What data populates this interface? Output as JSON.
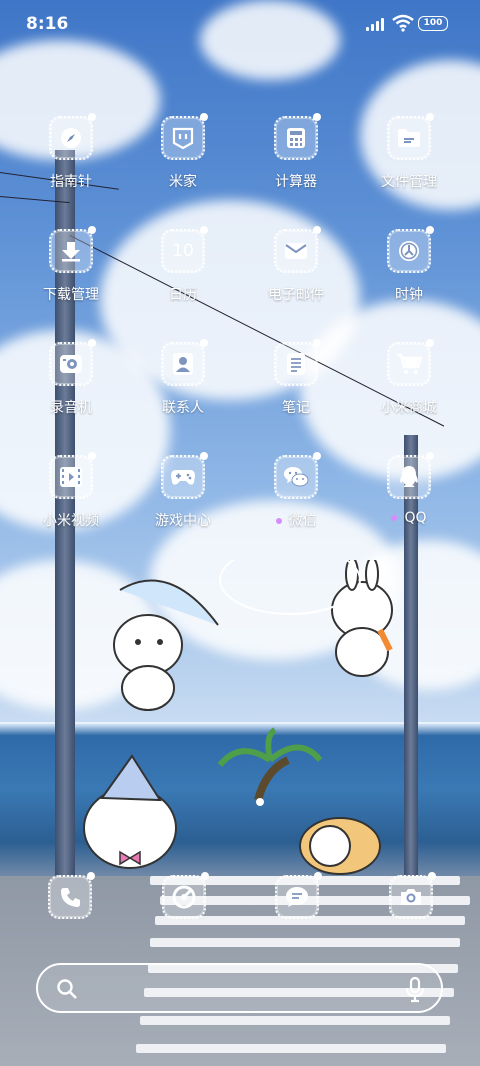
{
  "status_bar": {
    "time": "8:16",
    "battery": "100"
  },
  "apps": [
    {
      "label": "指南针",
      "icon": "compass-icon"
    },
    {
      "label": "米家",
      "icon": "mijia-icon"
    },
    {
      "label": "计算器",
      "icon": "calculator-icon"
    },
    {
      "label": "文件管理",
      "icon": "folder-icon"
    },
    {
      "label": "下载管理",
      "icon": "download-icon"
    },
    {
      "label": "日历",
      "icon": "calendar-icon",
      "glyph_text": "10"
    },
    {
      "label": "电子邮件",
      "icon": "mail-icon"
    },
    {
      "label": "时钟",
      "icon": "clock-icon"
    },
    {
      "label": "录音机",
      "icon": "recorder-icon"
    },
    {
      "label": "联系人",
      "icon": "contacts-icon"
    },
    {
      "label": "笔记",
      "icon": "notes-icon"
    },
    {
      "label": "小米商城",
      "icon": "shop-cart-icon"
    },
    {
      "label": "小米视频",
      "icon": "video-icon"
    },
    {
      "label": "游戏中心",
      "icon": "gamepad-icon"
    },
    {
      "label": "微信",
      "icon": "wechat-icon"
    },
    {
      "label": "QQ",
      "icon": "qq-icon"
    }
  ],
  "dock": [
    {
      "name": "phone",
      "icon": "phone-icon"
    },
    {
      "name": "browser",
      "icon": "browser-icon"
    },
    {
      "name": "messages",
      "icon": "message-icon"
    },
    {
      "name": "camera",
      "icon": "camera-icon"
    }
  ],
  "search": {
    "value": "",
    "placeholder": ""
  },
  "colors": {
    "notification_dot": "#d68cff",
    "icon_frame": "#ffffff"
  }
}
